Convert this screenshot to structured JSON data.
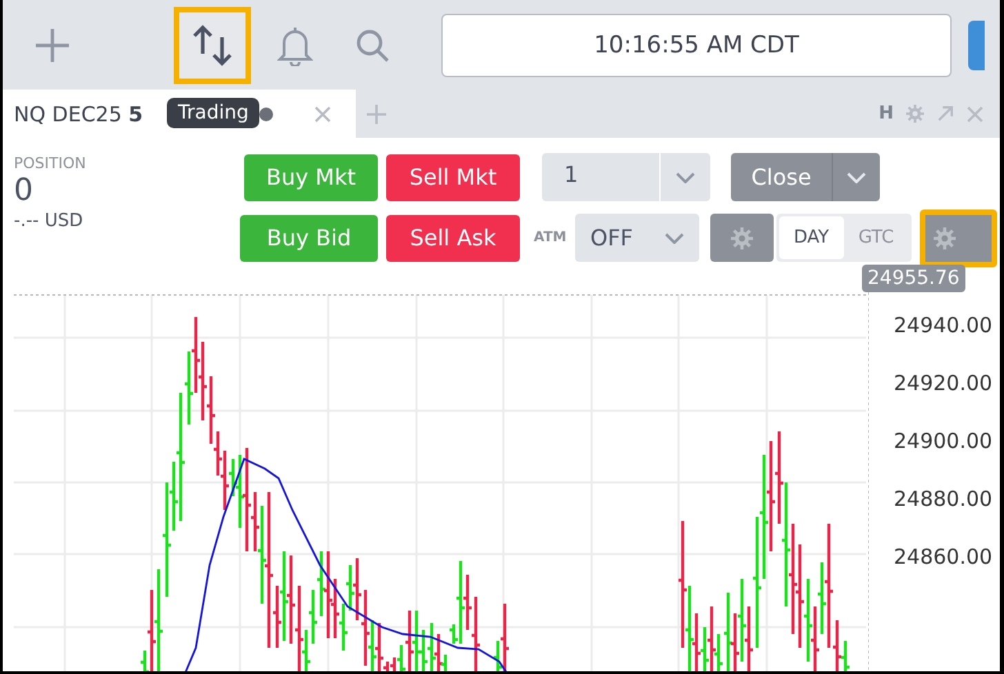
{
  "toolbar": {
    "buttons": [
      {
        "kind": "add",
        "highlighted": false
      },
      {
        "kind": "trading",
        "highlighted": true
      },
      {
        "kind": "alerts",
        "highlighted": false
      },
      {
        "kind": "search",
        "highlighted": false
      }
    ],
    "clock": "10:16:55 AM CDT",
    "tooltip": "Trading"
  },
  "tabs": [
    {
      "label": "NQ DEC25 **5**",
      "selected": true
    }
  ],
  "panel_controls": {
    "hide": "H"
  },
  "position": {
    "label": "POSITION",
    "quantity": "0",
    "pnl": "-.-- USD"
  },
  "order_buttons": [
    {
      "label": "Buy Mkt",
      "kind": "buy"
    },
    {
      "label": "Sell Mkt",
      "kind": "sell"
    },
    {
      "label": "Buy Bid",
      "kind": "buy"
    },
    {
      "label": "Sell Ask",
      "kind": "sell"
    }
  ],
  "quantity": {
    "value": "1"
  },
  "close_button": "Close",
  "atm": {
    "label": "ATM",
    "value": "OFF"
  },
  "duration": [
    {
      "label": "DAY",
      "selected": true
    },
    {
      "label": "GTC",
      "selected": false
    }
  ],
  "settings_buttons": [
    {
      "highlighted": false
    },
    {
      "highlighted": true
    }
  ],
  "price_axis": {
    "last_price": "24955.76",
    "labels": [
      "24940.00",
      "24920.00",
      "24900.00",
      "24880.00",
      "24860.00"
    ]
  }
}
